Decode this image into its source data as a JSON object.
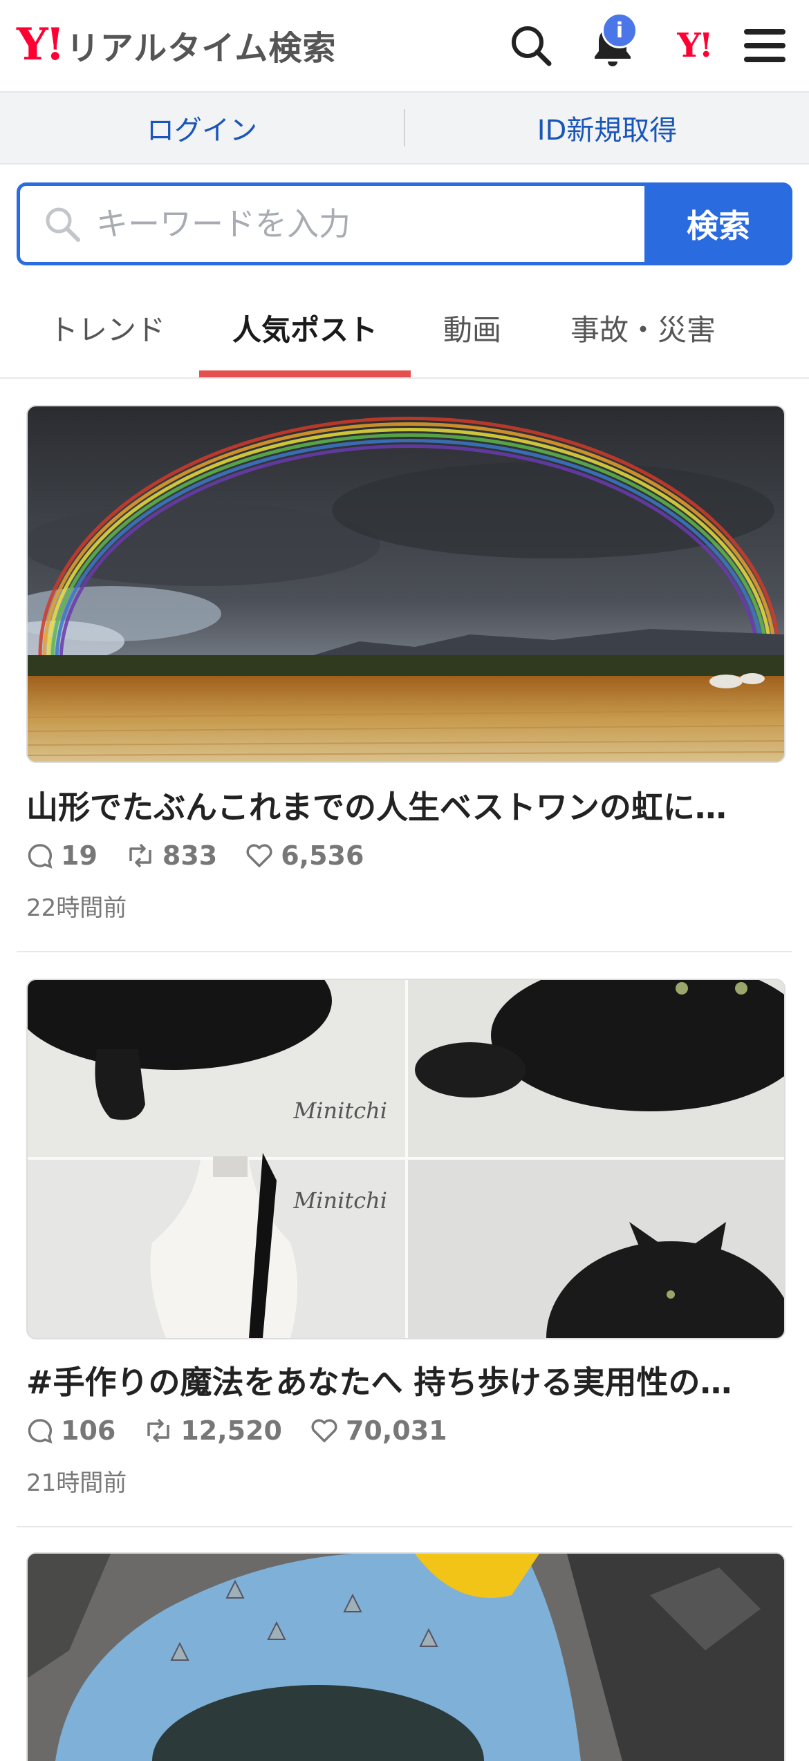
{
  "header": {
    "logo_y": "Y!",
    "logo_text": "リアルタイム検索",
    "notification_badge": "i",
    "yahoo_mark": "Y!"
  },
  "login_bar": {
    "login": "ログイン",
    "register": "ID新規取得"
  },
  "search": {
    "placeholder": "キーワードを入力",
    "button": "検索"
  },
  "tabs": [
    {
      "label": "トレンド",
      "active": false
    },
    {
      "label": "人気ポスト",
      "active": true
    },
    {
      "label": "動画",
      "active": false
    },
    {
      "label": "事故・災害",
      "active": false
    }
  ],
  "posts": [
    {
      "title": "山形でたぶんこれまでの人生ベストワンの虹に…",
      "replies": "19",
      "reposts": "833",
      "likes": "6,536",
      "time": "22時間前"
    },
    {
      "title": "#手作りの魔法をあなたへ 持ち歩ける実用性の…",
      "replies": "106",
      "reposts": "12,520",
      "likes": "70,031",
      "time": "21時間前",
      "watermark": "Minitchi"
    }
  ],
  "colors": {
    "brand_red": "#ff0033",
    "accent_blue": "#2b6be0",
    "tab_underline": "#e64f4f"
  }
}
